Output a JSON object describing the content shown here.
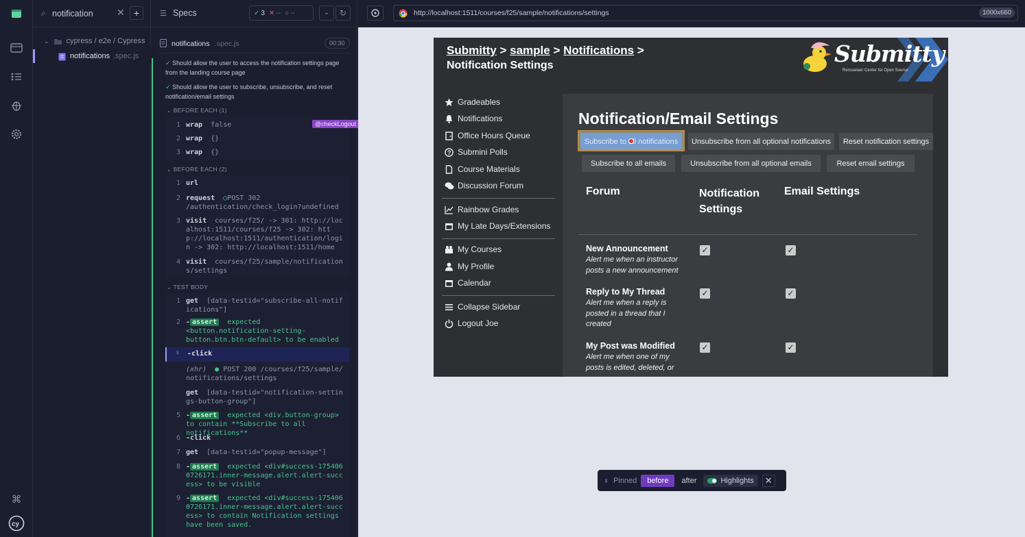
{
  "rail": {
    "icons": [
      "cypress-app-icon",
      "browser-icon",
      "list-icon",
      "debug-bug-icon",
      "settings-gear-icon",
      "keyboard-shortcut-icon",
      "cypress-logo-icon"
    ]
  },
  "specs": {
    "search_value": "notification",
    "folder": "cypress / e2e / Cypress",
    "file_name": "notifications",
    "file_ext": ".spec.js"
  },
  "reporter": {
    "title": "Specs",
    "passed": "3",
    "failed": "--",
    "pending": "--",
    "spec_name": "notifications",
    "spec_ext": ".spec.js",
    "duration": "00:30",
    "tests": [
      "Should allow the user to access the notification settings page from the landing course page",
      "Should allow the user to subscribe, unsubscribe, and reset notification/email settings"
    ],
    "before_each_1": "BEFORE EACH (1)",
    "before_each_2": "BEFORE EACH (2)",
    "test_body": "TEST BODY",
    "alias_badge": "@checkLogout",
    "be1": [
      {
        "num": "1",
        "name": "wrap",
        "msg": "false"
      },
      {
        "num": "2",
        "name": "wrap",
        "msg": "{}"
      },
      {
        "num": "3",
        "name": "wrap",
        "msg": "{}"
      }
    ],
    "be2": [
      {
        "num": "1",
        "name": "url",
        "msg": ""
      },
      {
        "num": "2",
        "name": "request",
        "msg": "POST 302 /authentication/check_login?undefined"
      },
      {
        "num": "3",
        "name": "visit",
        "msg": "courses/f25/ -> 301: http://localhost:1511/courses/f25 -> 302: http://localhost:1511/authentication/login -> 302: http://localhost:1511/home"
      },
      {
        "num": "4",
        "name": "visit",
        "msg": "courses/f25/sample/notifications/settings"
      }
    ],
    "body": [
      {
        "num": "1",
        "name": "get",
        "msg": "[data-testid=\"subscribe-all-notifications\"]"
      },
      {
        "num": "2",
        "name": "-assert",
        "msg": "expected <button.notification-setting-button.btn.btn-default> to be enabled"
      },
      {
        "num": "",
        "name": "-click",
        "msg": ""
      },
      {
        "num": "",
        "name": "(xhr)",
        "msg": "POST 200 /courses/f25/sample/notifications/settings"
      },
      {
        "num": "",
        "name": "get",
        "msg": "[data-testid=\"notification-settings-button-group\"]"
      },
      {
        "num": "5",
        "name": "-assert",
        "msg": "expected <div.button-group> to contain **Subscribe to all notifications**"
      },
      {
        "num": "6",
        "name": "-click",
        "msg": ""
      },
      {
        "num": "7",
        "name": "get",
        "msg": "[data-testid=\"popup-message\"]"
      },
      {
        "num": "8",
        "name": "-assert",
        "msg": "expected <div#success-1754060726171.inner-message.alert.alert-success> to be visible"
      },
      {
        "num": "9",
        "name": "-assert",
        "msg": "expected <div#success-1754060726171.inner-message.alert.alert-success> to contain Notification settings have been saved."
      }
    ]
  },
  "aut": {
    "url": "http://localhost:1511/courses/f25/sample/notifications/settings",
    "viewport": "1000x660"
  },
  "app": {
    "breadcrumb": [
      "Submitty",
      "sample",
      "Notifications"
    ],
    "sep": ">",
    "subtitle": "Notification Settings",
    "logo_text": "Submitty",
    "logo_tagline": "Rensselaer Center for Open Source",
    "sidebar": [
      {
        "label": "Gradeables",
        "icon": "star-icon"
      },
      {
        "label": "Notifications",
        "icon": "bell-icon"
      },
      {
        "label": "Office Hours Queue",
        "icon": "door-icon"
      },
      {
        "label": "Submini Polls",
        "icon": "question-icon"
      },
      {
        "label": "Course Materials",
        "icon": "file-icon"
      },
      {
        "label": "Discussion Forum",
        "icon": "comments-icon"
      },
      {
        "label": "Rainbow Grades",
        "icon": "chart-icon"
      },
      {
        "label": "My Late Days/Extensions",
        "icon": "calendar-icon"
      },
      {
        "label": "My Courses",
        "icon": "courses-icon"
      },
      {
        "label": "My Profile",
        "icon": "user-icon"
      },
      {
        "label": "Calendar",
        "icon": "calendar-icon"
      },
      {
        "label": "Collapse Sidebar",
        "icon": "menu-icon"
      },
      {
        "label": "Logout Joe",
        "icon": "power-icon"
      }
    ],
    "page_title": "Notification/Email Settings",
    "buttons_row1": [
      "Subscribe to all notifications",
      "Unsubscribe from all optional notifications",
      "Reset notification settings"
    ],
    "buttons_row2": [
      "Subscribe to all emails",
      "Unsubscribe from all optional emails",
      "Reset email settings"
    ],
    "col_forum": "Forum",
    "col_notif": "Notification Settings",
    "col_email": "Email Settings",
    "rows": [
      {
        "title": "New Announcement",
        "desc": "Alert me when an instructor posts a new announcement"
      },
      {
        "title": "Reply to My Thread",
        "desc": "Alert me when a reply is posted in a thread that I created"
      },
      {
        "title": "My Post was Modified",
        "desc": "Alert me when one of my posts is edited, deleted, or"
      }
    ]
  },
  "pin": {
    "label": "Pinned",
    "before": "before",
    "after": "after",
    "highlights": "Highlights"
  }
}
